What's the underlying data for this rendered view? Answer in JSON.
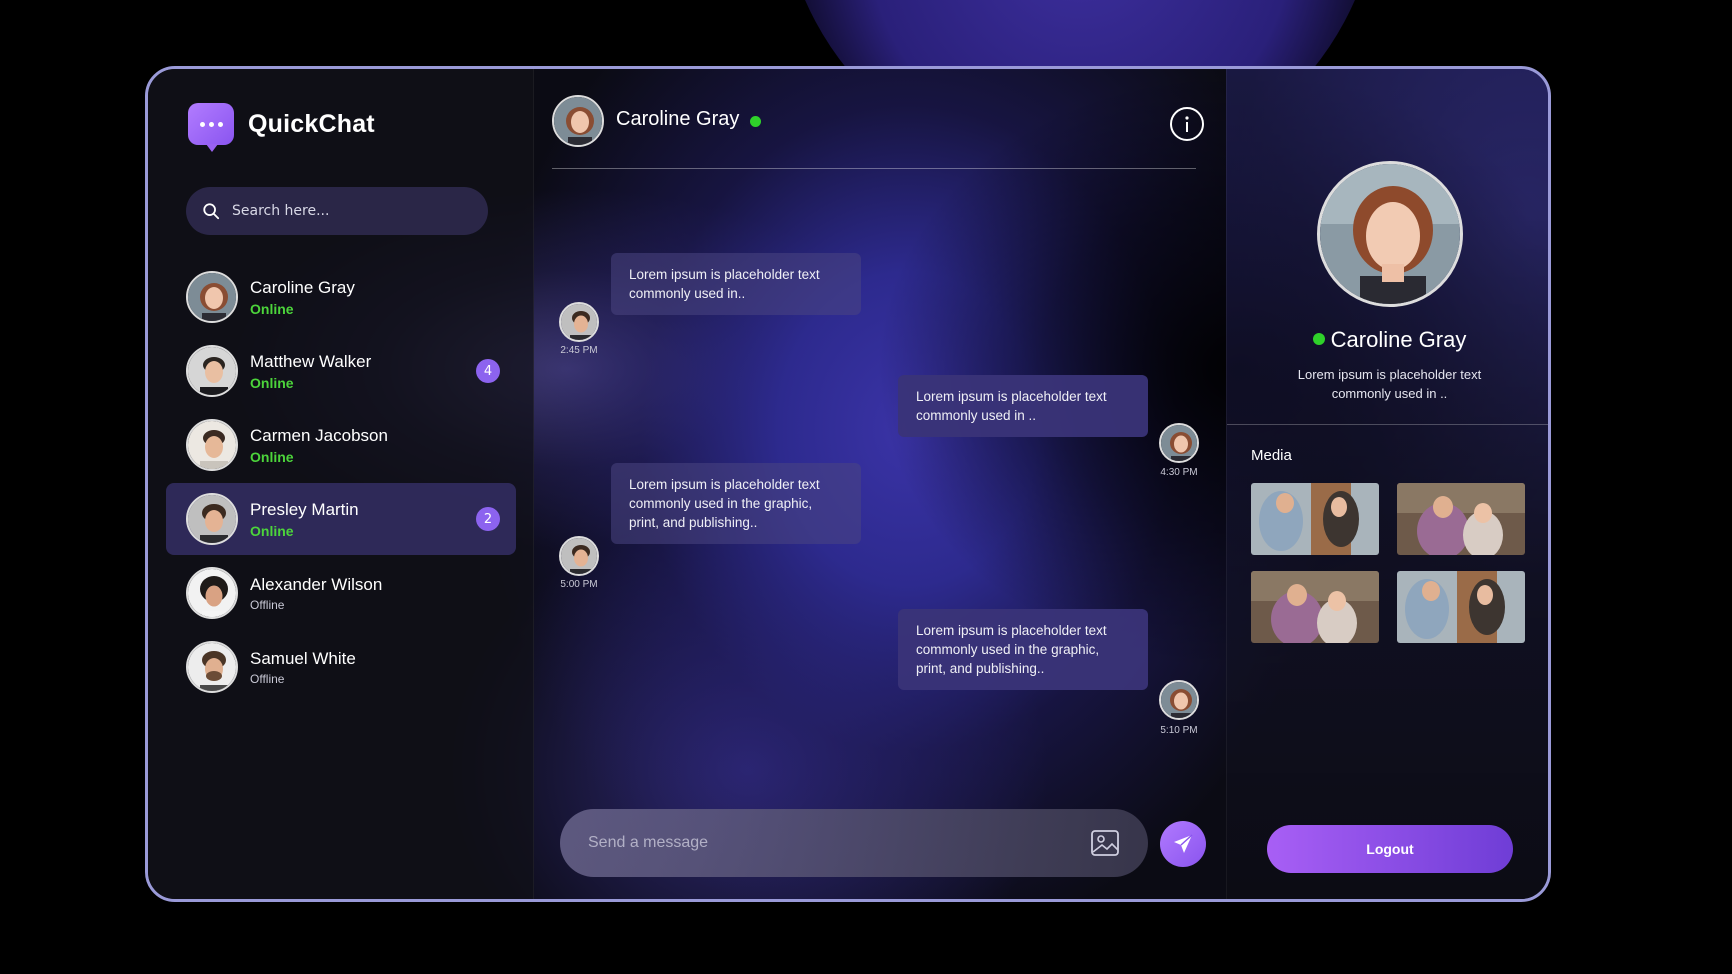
{
  "app": {
    "name": "QuickChat"
  },
  "search": {
    "placeholder": "Search here..."
  },
  "contacts": [
    {
      "name": "Caroline Gray",
      "status": "Online",
      "unread": ""
    },
    {
      "name": "Matthew Walker",
      "status": "Online",
      "unread": "4"
    },
    {
      "name": "Carmen Jacobson",
      "status": "Online",
      "unread": ""
    },
    {
      "name": "Presley Martin",
      "status": "Online",
      "unread": "2"
    },
    {
      "name": "Alexander Wilson",
      "status": "Offline",
      "unread": ""
    },
    {
      "name": "Samuel White",
      "status": "Offline",
      "unread": ""
    }
  ],
  "chat": {
    "contact_name": "Caroline Gray",
    "messages": [
      {
        "text": "Lorem ipsum is placeholder text commonly used in..",
        "time": "2:45 PM",
        "direction": "received"
      },
      {
        "text": "Lorem ipsum is placeholder text commonly used in ..",
        "time": "4:30 PM",
        "direction": "sent"
      },
      {
        "text": "Lorem ipsum is placeholder text commonly used in the graphic, print, and publishing..",
        "time": "5:00 PM",
        "direction": "received"
      },
      {
        "text": "Lorem ipsum is placeholder text commonly used in the graphic, print, and publishing..",
        "time": "5:10 PM",
        "direction": "sent"
      }
    ],
    "composer_placeholder": "Send a message"
  },
  "profile": {
    "name": "Caroline Gray",
    "bio": "Lorem ipsum is placeholder text commonly used in ..",
    "media_label": "Media",
    "logout_label": "Logout"
  },
  "colors": {
    "accent": "#8c63ef",
    "online": "#4cd43b",
    "border": "#9a9ad8"
  },
  "icons": [
    "search-icon",
    "info-icon",
    "image-icon",
    "send-icon",
    "chat-bubble-icon"
  ]
}
